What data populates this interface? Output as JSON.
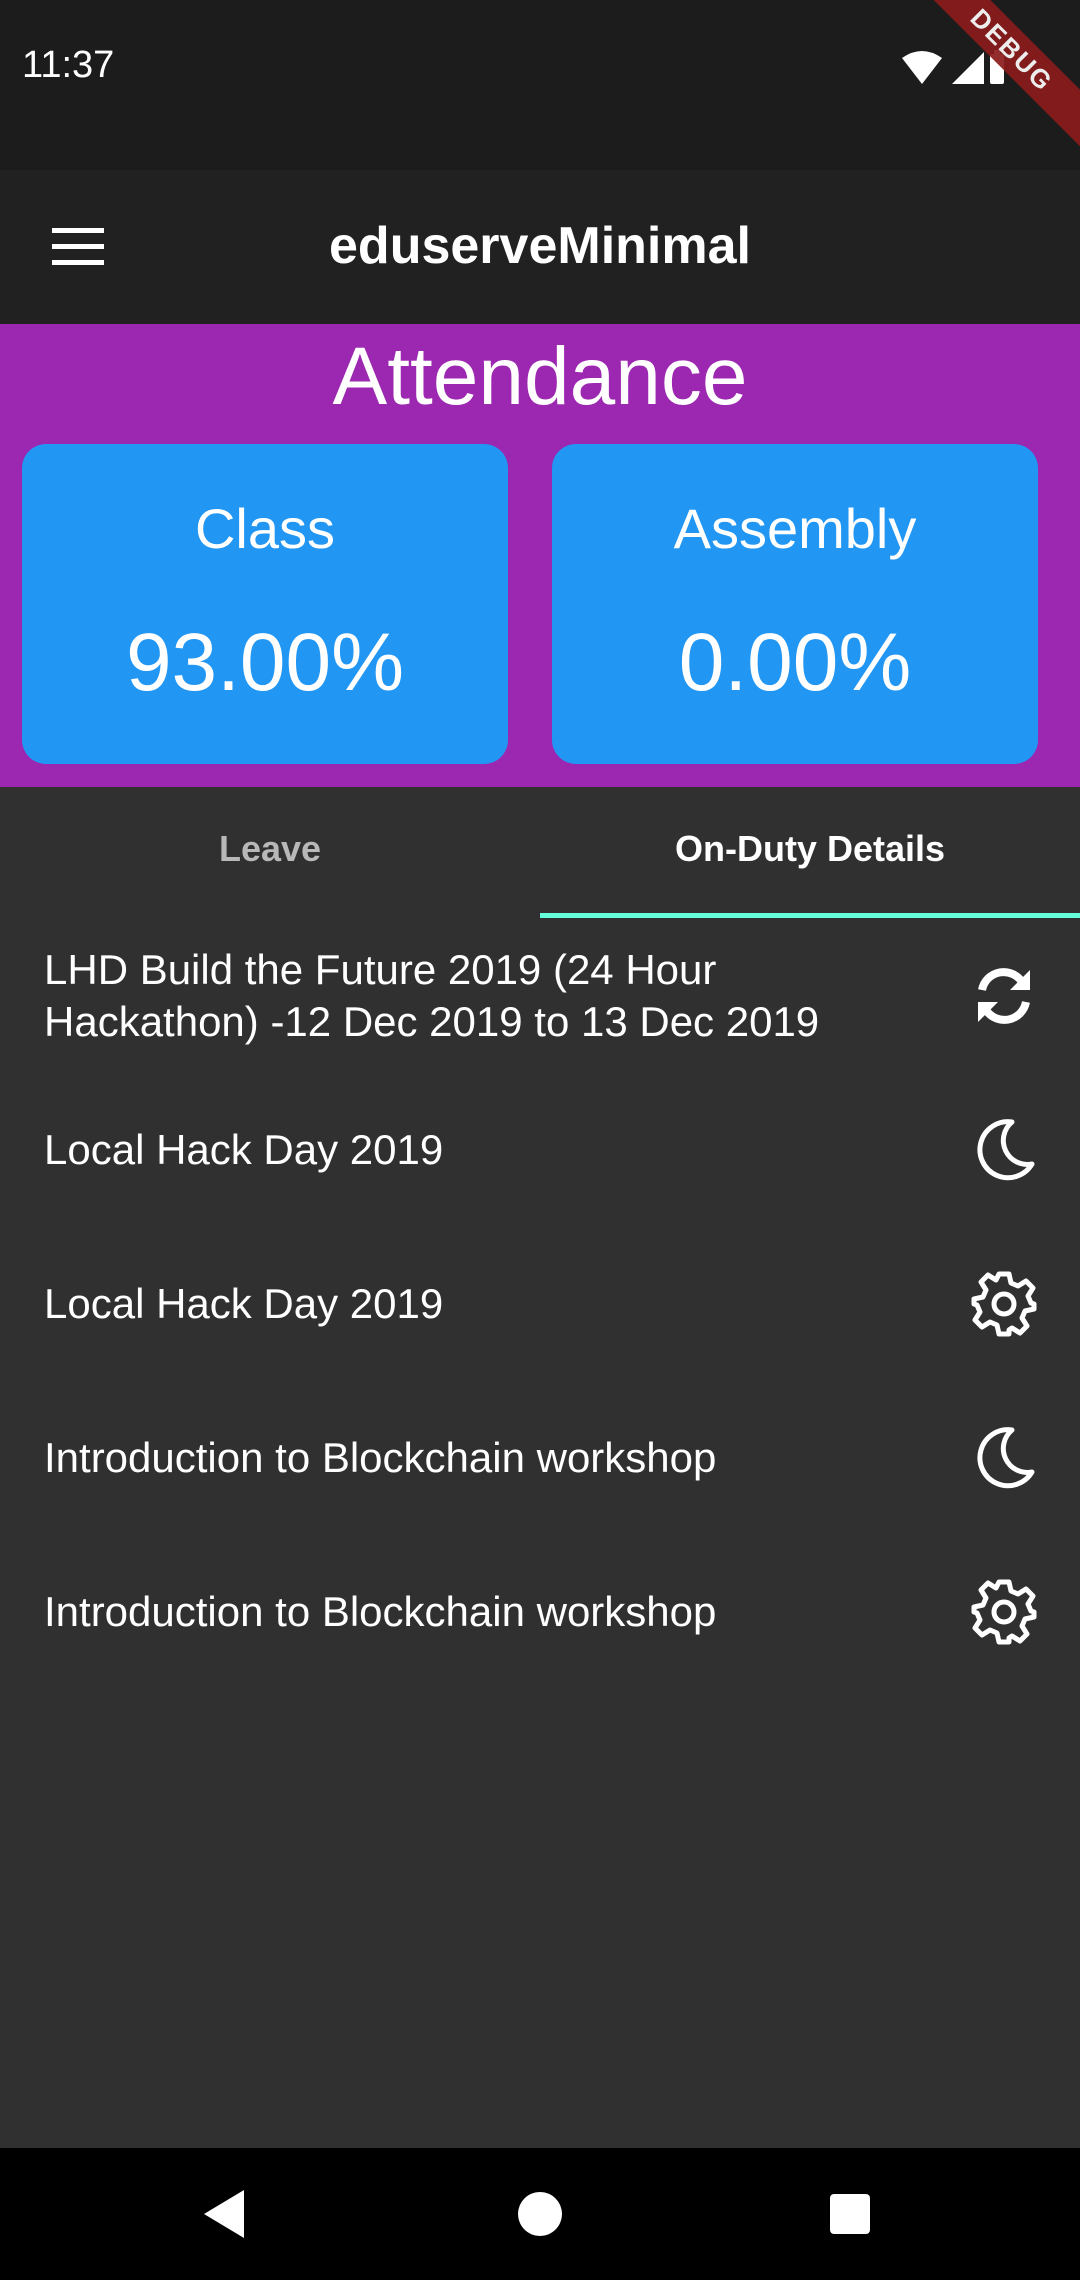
{
  "status_bar": {
    "time": "11:37",
    "icons": [
      "wifi-icon",
      "signal-icon",
      "battery-icon"
    ],
    "debug_label": "DEBUG"
  },
  "app_bar": {
    "title": "eduserveMinimal",
    "menu_icon": "menu-icon"
  },
  "attendance": {
    "title": "Attendance",
    "cards": [
      {
        "label": "Class",
        "value": "93.00%"
      },
      {
        "label": "Assembly",
        "value": "0.00%"
      }
    ]
  },
  "tabs": [
    {
      "label": "Leave",
      "selected": false
    },
    {
      "label": "On-Duty Details",
      "selected": true
    }
  ],
  "on_duty_items": [
    {
      "text": "LHD Build the Future 2019 (24 Hour Hackathon) -12 Dec 2019 to 13 Dec 2019",
      "icon": "sync-icon"
    },
    {
      "text": "Local Hack Day 2019",
      "icon": "moon-icon"
    },
    {
      "text": "Local Hack Day 2019",
      "icon": "gear-icon"
    },
    {
      "text": "Introduction to Blockchain workshop",
      "icon": "moon-icon"
    },
    {
      "text": "Introduction to Blockchain workshop",
      "icon": "gear-icon"
    }
  ],
  "nav_bar": {
    "buttons": [
      "back-icon",
      "home-icon",
      "recents-icon"
    ]
  },
  "colors": {
    "attendance_bg": "#9c27b0",
    "card_bg": "#2196f3",
    "tab_indicator": "#64ffda",
    "app_bar_bg": "#212121",
    "body_bg": "#303030"
  }
}
